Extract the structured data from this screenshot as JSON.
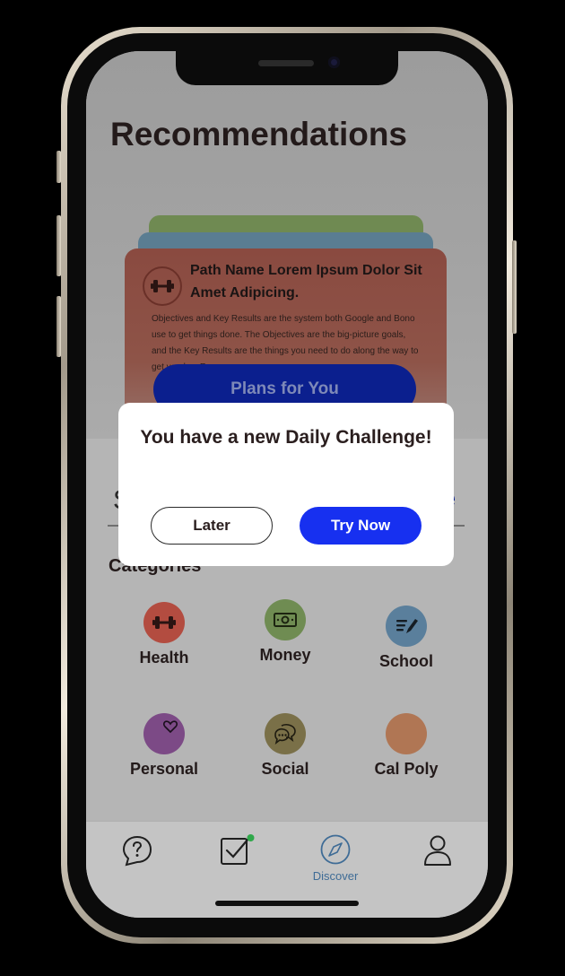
{
  "header": {
    "title": "Recommendations"
  },
  "path_card": {
    "title": "Path Name Lorem Ipsum Dolor Sit Amet Adipicing.",
    "description": "Objectives and Key Results are the system both Google and Bono use to get things done. The Objectives are the big-picture goals, and the Key Results are the things you need to do along the way to get you key Res",
    "icon": "dumbbell-icon",
    "plans_button": "Plans for You"
  },
  "search": {
    "leading_text": "S",
    "trailing_text": "e"
  },
  "categories": {
    "title": "Categories",
    "items": [
      {
        "label": "Health",
        "icon": "dumbbell-icon",
        "color": "#b34c40"
      },
      {
        "label": "Money",
        "icon": "money-icon",
        "color": "#6f8c52"
      },
      {
        "label": "School",
        "icon": "notes-pencil-icon",
        "color": "#5a7f9c"
      },
      {
        "label": "Personal",
        "icon": "heart-icon",
        "color": "#7c4a86"
      },
      {
        "label": "Social",
        "icon": "chat-bubbles-icon",
        "color": "#7a7048"
      },
      {
        "label": "Cal Poly",
        "icon": "blank-icon",
        "color": "#b07654"
      }
    ]
  },
  "modal": {
    "message": "You have a new Daily Challenge!",
    "later_label": "Later",
    "try_label": "Try Now"
  },
  "navbar": {
    "items": [
      {
        "icon": "help-chat-icon",
        "label": ""
      },
      {
        "icon": "checklist-icon",
        "label": "",
        "badge_color": "#2fa84a"
      },
      {
        "icon": "compass-icon",
        "label": "Discover"
      },
      {
        "icon": "profile-icon",
        "label": ""
      }
    ]
  },
  "colors": {
    "accent": "#1730f0",
    "active_nav": "#3f6c96"
  }
}
